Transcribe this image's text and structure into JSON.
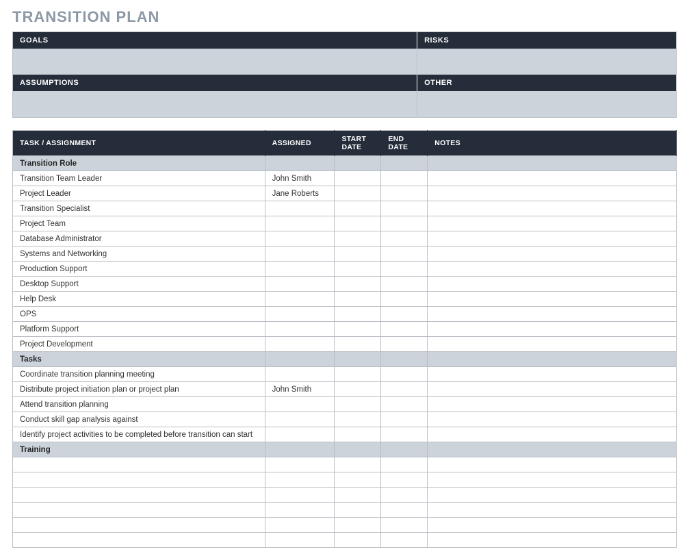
{
  "title": "TRANSITION PLAN",
  "top": {
    "goals_label": "GOALS",
    "risks_label": "RISKS",
    "assumptions_label": "ASSUMPTIONS",
    "other_label": "OTHER",
    "goals_value": "",
    "risks_value": "",
    "assumptions_value": "",
    "other_value": ""
  },
  "table": {
    "headers": {
      "task": "TASK / ASSIGNMENT",
      "assigned": "ASSIGNED",
      "start": "START DATE",
      "end": "END DATE",
      "notes": "NOTES"
    },
    "rows": [
      {
        "type": "section",
        "task": "Transition Role",
        "assigned": "",
        "start": "",
        "end": "",
        "notes": ""
      },
      {
        "type": "data",
        "task": "Transition Team Leader",
        "assigned": "John Smith",
        "start": "",
        "end": "",
        "notes": ""
      },
      {
        "type": "data",
        "task": "Project Leader",
        "assigned": "Jane Roberts",
        "start": "",
        "end": "",
        "notes": ""
      },
      {
        "type": "data",
        "task": "Transition Specialist",
        "assigned": "",
        "start": "",
        "end": "",
        "notes": ""
      },
      {
        "type": "data",
        "task": "Project Team",
        "assigned": "",
        "start": "",
        "end": "",
        "notes": ""
      },
      {
        "type": "data",
        "task": "Database Administrator",
        "assigned": "",
        "start": "",
        "end": "",
        "notes": ""
      },
      {
        "type": "data",
        "task": "Systems and Networking",
        "assigned": "",
        "start": "",
        "end": "",
        "notes": ""
      },
      {
        "type": "data",
        "task": "Production Support",
        "assigned": "",
        "start": "",
        "end": "",
        "notes": ""
      },
      {
        "type": "data",
        "task": "Desktop Support",
        "assigned": "",
        "start": "",
        "end": "",
        "notes": ""
      },
      {
        "type": "data",
        "task": "Help Desk",
        "assigned": "",
        "start": "",
        "end": "",
        "notes": ""
      },
      {
        "type": "data",
        "task": "OPS",
        "assigned": "",
        "start": "",
        "end": "",
        "notes": ""
      },
      {
        "type": "data",
        "task": "Platform Support",
        "assigned": "",
        "start": "",
        "end": "",
        "notes": ""
      },
      {
        "type": "data",
        "task": "Project Development",
        "assigned": "",
        "start": "",
        "end": "",
        "notes": ""
      },
      {
        "type": "section",
        "task": "Tasks",
        "assigned": "",
        "start": "",
        "end": "",
        "notes": ""
      },
      {
        "type": "data",
        "task": "Coordinate transition planning meeting",
        "assigned": "",
        "start": "",
        "end": "",
        "notes": ""
      },
      {
        "type": "data",
        "task": "Distribute project initiation plan or project plan",
        "assigned": "John Smith",
        "start": "",
        "end": "",
        "notes": ""
      },
      {
        "type": "data",
        "task": "Attend transition planning",
        "assigned": "",
        "start": "",
        "end": "",
        "notes": ""
      },
      {
        "type": "data",
        "task": "Conduct skill gap analysis against",
        "assigned": "",
        "start": "",
        "end": "",
        "notes": ""
      },
      {
        "type": "data",
        "task": "Identify project activities to be completed before transition can start",
        "assigned": "",
        "start": "",
        "end": "",
        "notes": ""
      },
      {
        "type": "section",
        "task": "Training",
        "assigned": "",
        "start": "",
        "end": "",
        "notes": ""
      },
      {
        "type": "data",
        "task": "",
        "assigned": "",
        "start": "",
        "end": "",
        "notes": ""
      },
      {
        "type": "data",
        "task": "",
        "assigned": "",
        "start": "",
        "end": "",
        "notes": ""
      },
      {
        "type": "data",
        "task": "",
        "assigned": "",
        "start": "",
        "end": "",
        "notes": ""
      },
      {
        "type": "data",
        "task": "",
        "assigned": "",
        "start": "",
        "end": "",
        "notes": ""
      },
      {
        "type": "data",
        "task": "",
        "assigned": "",
        "start": "",
        "end": "",
        "notes": ""
      },
      {
        "type": "data",
        "task": "",
        "assigned": "",
        "start": "",
        "end": "",
        "notes": ""
      }
    ]
  }
}
